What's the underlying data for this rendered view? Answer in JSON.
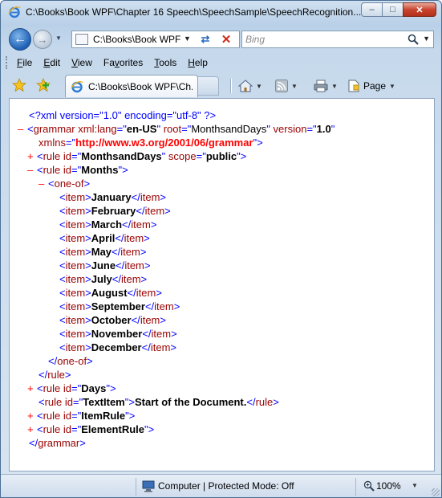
{
  "window": {
    "title": "C:\\Books\\Book WPF\\Chapter 16 Speech\\SpeechSample\\SpeechRecognition...",
    "minimize_label": "–",
    "maximize_label": "□",
    "close_label": "✕"
  },
  "nav": {
    "back_glyph": "←",
    "forward_glyph": "→",
    "address": "C:\\Books\\Book WPF",
    "refresh_glyph": "⇄",
    "stop_glyph": "✕",
    "search_placeholder": "Bing"
  },
  "menu": {
    "items": [
      {
        "key": "F",
        "rest": "ile"
      },
      {
        "key": "E",
        "rest": "dit"
      },
      {
        "key": "V",
        "rest": "iew"
      },
      {
        "key": "",
        "rest": "Favorites",
        "ul_index": 2
      },
      {
        "key": "T",
        "rest": "ools"
      },
      {
        "key": "H",
        "rest": "elp"
      }
    ],
    "favorites_label_pre": "Fa",
    "favorites_label_u": "v",
    "favorites_label_post": "orites"
  },
  "tabs": {
    "active_title": "C:\\Books\\Book WPF\\Ch...",
    "page_label": "Page"
  },
  "xml": {
    "decl": "<?xml version=\"1.0\" encoding=\"utf-8\" ?>",
    "grammar_open_attrs": [
      {
        "name": "xml:lang",
        "value": "en-US"
      },
      {
        "name": "root",
        "value": "MonthsandDays"
      },
      {
        "name": "version",
        "value": "1.0"
      }
    ],
    "xmlns_name": "xmlns",
    "xmlns_value": "http://www.w3.org/2001/06/grammar",
    "rule_monthsanddays_id": "MonthsandDays",
    "rule_monthsanddays_scope": "public",
    "rule_months_id": "Months",
    "months": [
      "January",
      "February",
      "March",
      "April",
      "May",
      "June",
      "July",
      "August",
      "September",
      "October",
      "November",
      "December"
    ],
    "rule_days_id": "Days",
    "rule_textitem_id": "TextItem",
    "rule_textitem_text": "Start of the Document.",
    "rule_itemrule_id": "ItemRule",
    "rule_elementrule_id": "ElementRule"
  },
  "status": {
    "zone": "Computer | Protected Mode: Off",
    "zoom": "100%"
  },
  "colors": {
    "tag": "#990000",
    "bracket": "#0000ff",
    "expander": "#ff0000",
    "namespace": "#ff0000"
  }
}
